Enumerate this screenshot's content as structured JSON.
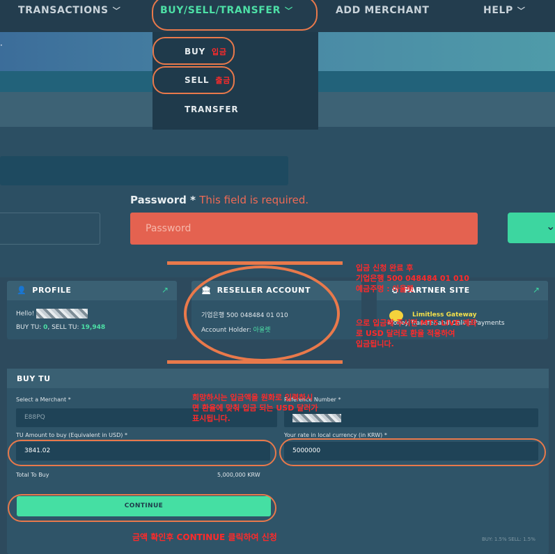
{
  "nav": {
    "items": [
      {
        "label": "TRANSACTIONS",
        "chevron": "﹀"
      },
      {
        "label": "BUY/SELL/TRANSFER",
        "chevron": "﹀"
      },
      {
        "label": "ADD MERCHANT",
        "chevron": ""
      },
      {
        "label": "HELP",
        "chevron": "﹀"
      }
    ]
  },
  "dropdown": {
    "items": [
      {
        "label": "BUY",
        "note": "입금"
      },
      {
        "label": "SELL",
        "note": "출금"
      },
      {
        "label": "TRANSFER",
        "note": ""
      }
    ]
  },
  "form": {
    "password_label": "Password",
    "required_star": "*",
    "error": "This field is required.",
    "password_placeholder": "Password",
    "chevron": "⌄"
  },
  "profile": {
    "title": "PROFILE",
    "hello": "Hello!",
    "buy_tu_label": "BUY TU: ",
    "buy_tu": "0",
    "sell_tu_label": ", SELL TU: ",
    "sell_tu": "19,948"
  },
  "reseller": {
    "title": "RESELLER ACCOUNT",
    "bank_line": "기업은행 500 048484 01 010",
    "holder_label": "Account Holder: ",
    "holder": "아울렛"
  },
  "partner": {
    "title": "PARTNER SITE",
    "name": "Limitless Gateway",
    "sub": "Money Transfer and Online Payments"
  },
  "buy_tu": {
    "title": "BUY TU",
    "merchant_label": "Select a Merchant *",
    "merchant_value": "E88PQ",
    "ref_label": "Reference Number *",
    "amount_label": "TU Amount to buy (Equivalent in USD) *",
    "amount_value": "3841.02",
    "rate_label": "Your rate in local currency (in KRW) *",
    "rate_value": "5000000",
    "total_label": "Total To Buy",
    "total_value": "5,000,000 KRW",
    "continue_label": "CONTINUE",
    "fee_note": "BUY: 1.5% SELL: 1.5%"
  },
  "annotations": {
    "reseller_note": [
      "입금 신청 완료 후",
      "기업은행 500 048484 01 010",
      "예금주명 : 아울렛"
    ],
    "partner_note": [
      "으로 입금해 주시면 MT5 LIVE 계좌",
      "로 USD 달러로 환율 적용하여",
      "입금됩니다."
    ],
    "amount_note": [
      "희망하시는 입금액을 원화로 입력하시",
      "면 환율에 맞춰 입금 되는 USD 달러가",
      "표시됩니다."
    ],
    "continue_note": "금액 확인후 CONTINUE 클릭하여 신청"
  },
  "colors": {
    "accent_green": "#4de0a6",
    "error_red": "#e46250",
    "annotation_orange": "#e9794b",
    "annotation_red": "#ff2a2a"
  }
}
